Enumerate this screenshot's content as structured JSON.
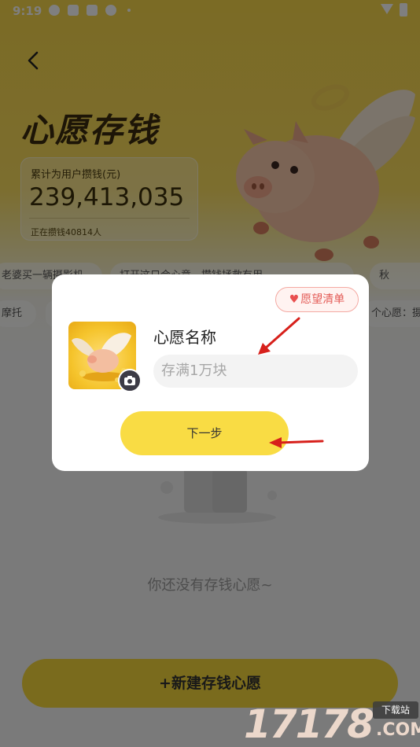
{
  "status_bar": {
    "time": "9:19"
  },
  "header": {
    "back_icon": "chevron-left-icon"
  },
  "hero": {
    "title": "心愿存钱",
    "stats_label": "累计为用户攒钱(元)",
    "stats_value": "239,413,035",
    "stats_sub": "正在攒钱40814人"
  },
  "tickers": [
    {
      "text": "老婆买一辆摄影机"
    },
    {
      "text": "打开这只合心意，攒钱拯救有用..."
    },
    {
      "text": "秋"
    },
    {
      "text": "摩托"
    },
    {
      "text": "个心愿：摄"
    }
  ],
  "empty_state": {
    "text": "你还没有存钱心愿~"
  },
  "new_wish_button": {
    "label": "+新建存钱心愿"
  },
  "watermark": {
    "number": "17178",
    "tag": "下载站",
    "com": ".COM"
  },
  "dialog": {
    "wish_list_badge": "愿望清单",
    "field_label": "心愿名称",
    "field_placeholder": "存满1万块",
    "next_button": "下一步"
  },
  "colors": {
    "accent": "#f9dc44",
    "badge": "#e35a55",
    "annotation_arrow": "#d7201b"
  }
}
